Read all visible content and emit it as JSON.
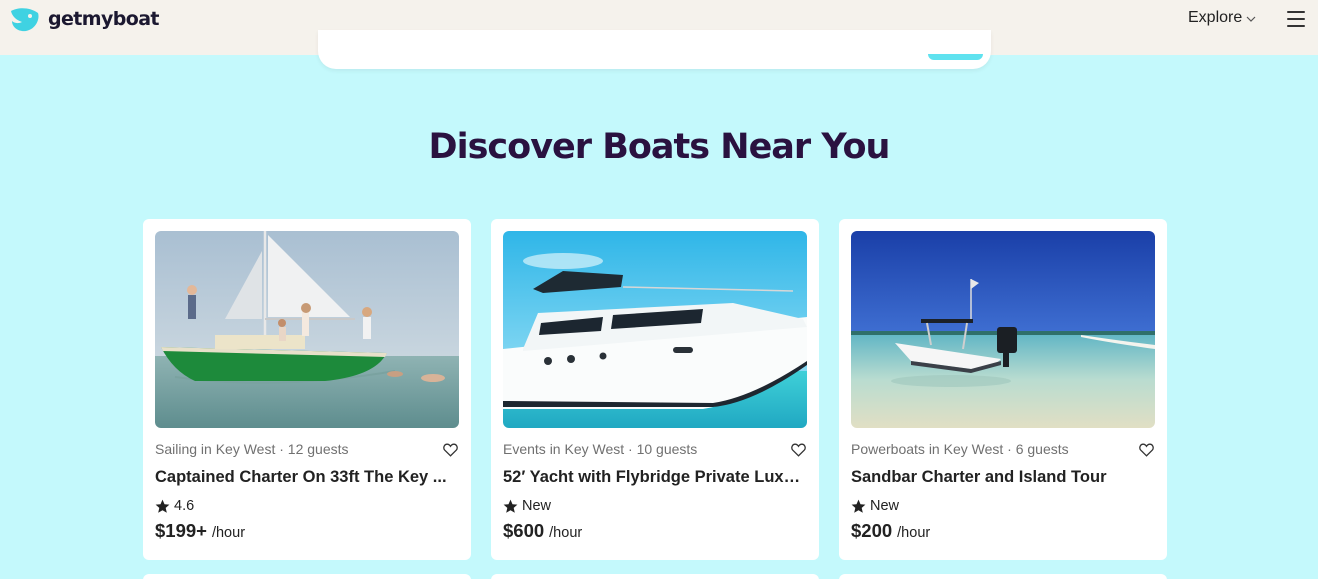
{
  "brand": {
    "name": "getmyboat",
    "accent": "#3fd2e2",
    "heading_color": "#2a1240"
  },
  "nav": {
    "explore_label": "Explore",
    "menu_icon": "hamburger-icon",
    "chevron_icon": "chevron-down-icon"
  },
  "main": {
    "heading": "Discover Boats Near You",
    "listings": [
      {
        "meta": "Sailing in Key West · 12 guests",
        "title": "Captained Charter On 33ft The Key ...",
        "rating": "4.6",
        "price": "$199+",
        "unit": "/hour",
        "image": "green-sailboat-photo"
      },
      {
        "meta": "Events in Key West · 10 guests",
        "title": "52′ Yacht with Flybridge Private Luxu...",
        "rating": "New",
        "price": "$600",
        "unit": "/hour",
        "image": "white-yacht-photo"
      },
      {
        "meta": "Powerboats in Key West · 6 guests",
        "title": "Sandbar Charter and Island Tour",
        "rating": "New",
        "price": "$200",
        "unit": "/hour",
        "image": "powerboat-sandbar-photo"
      }
    ]
  }
}
